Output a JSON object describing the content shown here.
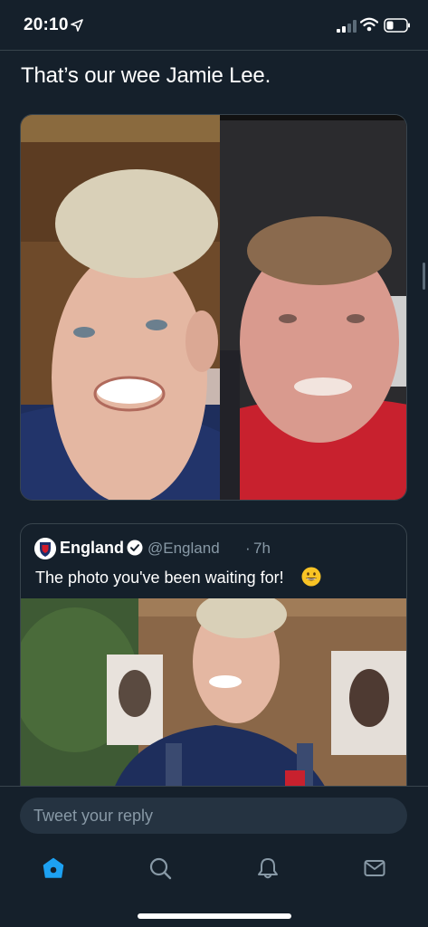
{
  "status_bar": {
    "time": "20:10",
    "icons": [
      "location-arrow-icon",
      "cellular-signal-icon",
      "wifi-icon",
      "battery-icon"
    ]
  },
  "tweet": {
    "text": "That’s our wee Jamie Lee."
  },
  "quoted_tweet": {
    "name": "England",
    "handle": "@England",
    "separator": "·",
    "time": "7h",
    "text": "The photo you've been waiting for!",
    "emoji": "grinning-face-icon",
    "verified": true
  },
  "reply": {
    "placeholder": "Tweet your reply"
  },
  "tab_bar": {
    "items": [
      "home-icon",
      "search-icon",
      "notifications-icon",
      "messages-icon"
    ],
    "active": "home"
  },
  "colors": {
    "background": "#15202b",
    "accent": "#1da1f2",
    "secondary_text": "#8899a6",
    "border": "#38444d"
  }
}
